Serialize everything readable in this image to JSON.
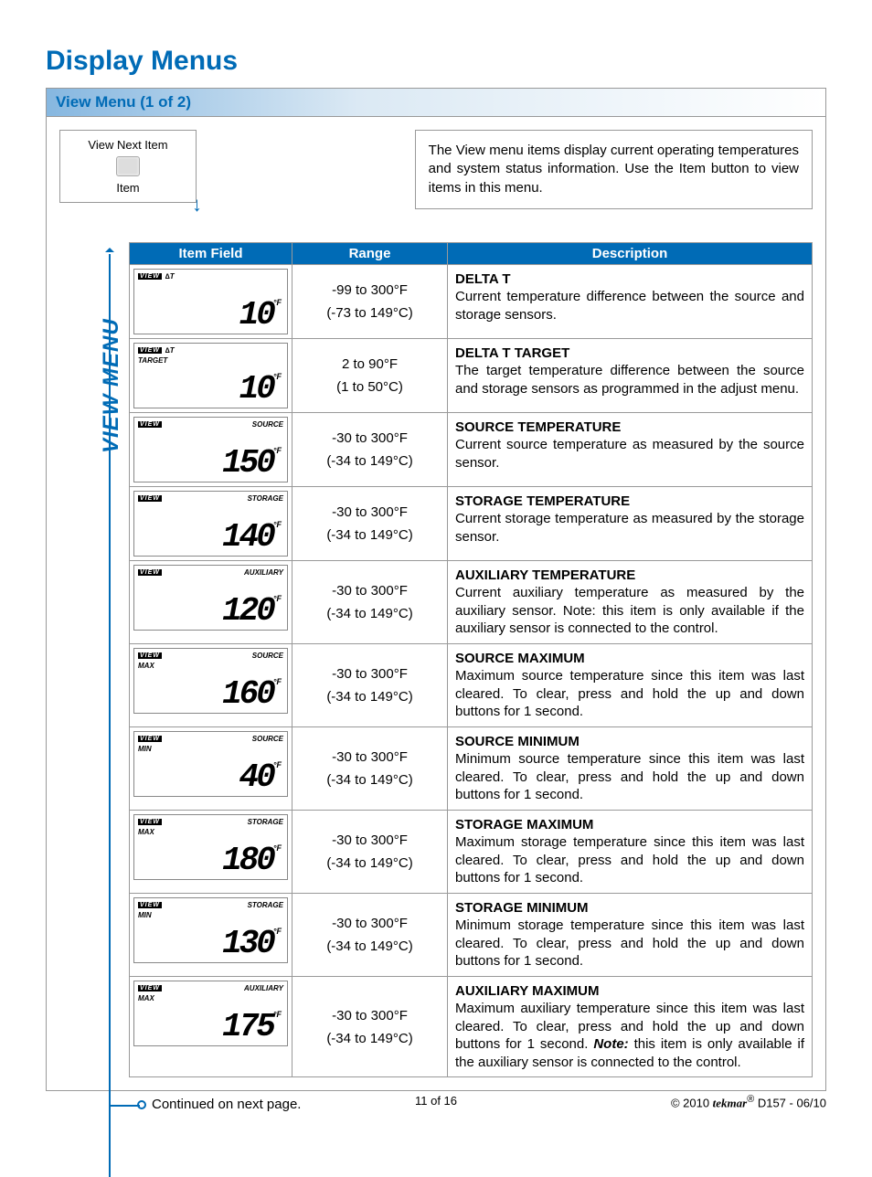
{
  "title": "Display Menus",
  "section_header": "View Menu (1 of 2)",
  "view_next": {
    "label_top": "View Next Item",
    "label_bottom": "Item"
  },
  "intro": "The View menu items display current operating temperatures and system status information. Use the Item button to view items in this menu.",
  "headers": {
    "item": "Item Field",
    "range": "Range",
    "desc": "Description"
  },
  "side_label": "VIEW MENU",
  "view_tag": "VIEW",
  "unit_f": "°F",
  "rows": [
    {
      "lcd_top": "∆T",
      "lcd_sub": "",
      "lcd_val": "10",
      "range_f": "-99 to 300°F",
      "range_c": "(-73 to 149°C)",
      "title": "DELTA T",
      "body": "Current temperature difference between the source and storage sensors."
    },
    {
      "lcd_top": "∆T",
      "lcd_sub": "TARGET",
      "lcd_val": "10",
      "range_f": "2 to 90°F",
      "range_c": "(1 to 50°C)",
      "title": "DELTA T TARGET",
      "body": "The target temperature difference between the source and storage sensors as programmed in the adjust menu."
    },
    {
      "lcd_top": "SOURCE",
      "lcd_sub": "",
      "lcd_val": "150",
      "range_f": "-30 to 300°F",
      "range_c": "(-34 to 149°C)",
      "title": "SOURCE TEMPERATURE",
      "body": "Current source temperature as measured by the source sensor."
    },
    {
      "lcd_top": "STORAGE",
      "lcd_sub": "",
      "lcd_val": "140",
      "range_f": "-30 to 300°F",
      "range_c": "(-34 to 149°C)",
      "title": "STORAGE TEMPERATURE",
      "body": "Current storage temperature as measured by the storage sensor."
    },
    {
      "lcd_top": "AUXILIARY",
      "lcd_sub": "",
      "lcd_val": "120",
      "range_f": "-30 to 300°F",
      "range_c": "(-34 to 149°C)",
      "title": "AUXILIARY TEMPERATURE",
      "body": "Current auxiliary temperature as measured by the auxiliary sensor. Note: this item is only available if the auxiliary sensor is connected to the control."
    },
    {
      "lcd_top": "SOURCE",
      "lcd_sub": "MAX",
      "lcd_val": "160",
      "range_f": "-30 to 300°F",
      "range_c": "(-34 to 149°C)",
      "title": "SOURCE MAXIMUM",
      "body": "Maximum source temperature since this item was last cleared. To clear, press and hold the up and down buttons for 1 second."
    },
    {
      "lcd_top": "SOURCE",
      "lcd_sub": "MIN",
      "lcd_val": "40",
      "range_f": "-30 to 300°F",
      "range_c": "(-34 to 149°C)",
      "title": "SOURCE MINIMUM",
      "body": "Minimum source temperature since this item was last cleared. To clear, press and hold the up and down buttons for 1 second."
    },
    {
      "lcd_top": "STORAGE",
      "lcd_sub": "MAX",
      "lcd_val": "180",
      "range_f": "-30 to 300°F",
      "range_c": "(-34 to 149°C)",
      "title": "STORAGE MAXIMUM",
      "body": "Maximum storage temperature since this item was last cleared. To clear, press and hold the up and down buttons for 1 second."
    },
    {
      "lcd_top": "STORAGE",
      "lcd_sub": "MIN",
      "lcd_val": "130",
      "range_f": "-30 to 300°F",
      "range_c": "(-34 to 149°C)",
      "title": "STORAGE MINIMUM",
      "body": "Minimum storage temperature since this item was last cleared. To clear, press and hold the up and down buttons for 1 second."
    },
    {
      "lcd_top": "AUXILIARY",
      "lcd_sub": "MAX",
      "lcd_val": "175",
      "range_f": "-30 to 300°F",
      "range_c": "(-34 to 149°C)",
      "title": "AUXILIARY MAXIMUM",
      "body": "Maximum auxiliary temperature since this item was last cleared. To clear, press and hold the up and down buttons for 1 second.",
      "note": "Note:",
      "note_body": " this item is only available if the auxiliary sensor is connected to the control."
    }
  ],
  "continued": "Continued on next page.",
  "footer": {
    "page": "11 of 16",
    "copyright": "© 2010 ",
    "brand": "tekmar",
    "reg": "®",
    "doc": " D157 - 06/10"
  }
}
